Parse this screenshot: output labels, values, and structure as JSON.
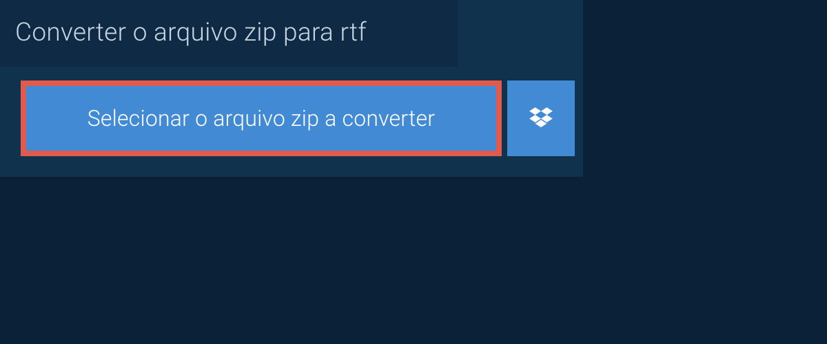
{
  "header": {
    "title": "Converter o arquivo zip para rtf"
  },
  "buttons": {
    "select_label": "Selecionar o arquivo zip a converter"
  },
  "colors": {
    "panel_bg": "#11324c",
    "header_bg": "#0f2a44",
    "page_bg": "#0b2138",
    "button_bg": "#428bd4",
    "highlight_border": "#e15a4e",
    "text_light": "#c7d5e0",
    "text_white": "#ffffff"
  }
}
